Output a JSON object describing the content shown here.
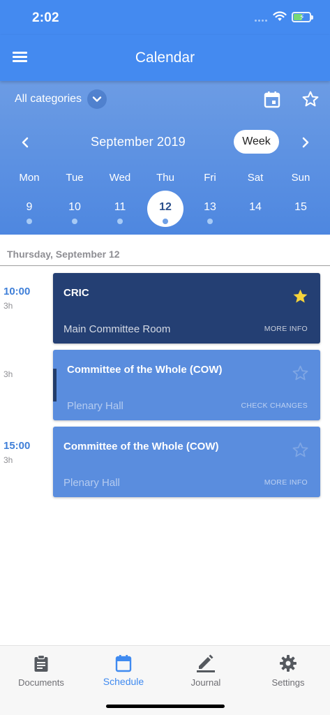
{
  "status_bar": {
    "time": "2:02"
  },
  "nav": {
    "title": "Calendar"
  },
  "filter": {
    "category_label": "All categories"
  },
  "calendar": {
    "month_label": "September 2019",
    "view_toggle": "Week",
    "days": [
      {
        "dow": "Mon",
        "date": "9",
        "has_events": true,
        "selected": false
      },
      {
        "dow": "Tue",
        "date": "10",
        "has_events": true,
        "selected": false
      },
      {
        "dow": "Wed",
        "date": "11",
        "has_events": true,
        "selected": false
      },
      {
        "dow": "Thu",
        "date": "12",
        "has_events": true,
        "selected": true
      },
      {
        "dow": "Fri",
        "date": "13",
        "has_events": true,
        "selected": false
      },
      {
        "dow": "Sat",
        "date": "14",
        "has_events": false,
        "selected": false
      },
      {
        "dow": "Sun",
        "date": "15",
        "has_events": false,
        "selected": false
      }
    ]
  },
  "schedule": {
    "day_heading": "Thursday, September 12",
    "events": [
      {
        "time": "10:00",
        "duration": "3h",
        "title": "CRIC",
        "room": "Main Committee Room",
        "action": "MORE INFO",
        "starred": true
      },
      {
        "time": "",
        "duration": "3h",
        "title": "Committee of the Whole (COW)",
        "room": "Plenary Hall",
        "action": "CHECK CHANGES",
        "starred": false
      },
      {
        "time": "15:00",
        "duration": "3h",
        "title": "Committee of the Whole (COW)",
        "room": "Plenary Hall",
        "action": "MORE INFO",
        "starred": false
      }
    ]
  },
  "tabs": [
    {
      "label": "Documents",
      "icon": "clipboard-icon",
      "active": false
    },
    {
      "label": "Schedule",
      "icon": "calendar-icon",
      "active": true
    },
    {
      "label": "Journal",
      "icon": "pencil-icon",
      "active": false
    },
    {
      "label": "Settings",
      "icon": "gear-icon",
      "active": false
    }
  ],
  "colors": {
    "primary": "#448AF0",
    "header_gradient_top": "#6C9CE4",
    "event_dark": "#243F73",
    "event_light": "#5A8DDE",
    "star_filled": "#F5D33B",
    "tab_active": "#3F8AF0"
  }
}
